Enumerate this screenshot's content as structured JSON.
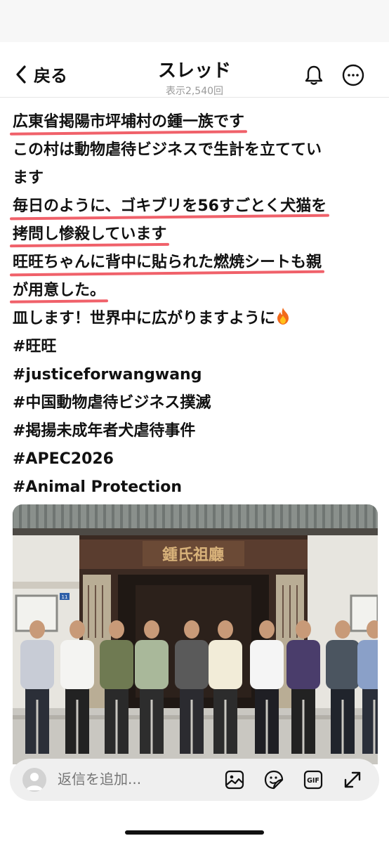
{
  "header": {
    "back_label": "戻る",
    "title": "スレッド",
    "views": "表示2,540回"
  },
  "post": {
    "lines": [
      "広東省掲陽市坪埔村の鍾一族です",
      "この村は動物虐待ビジネスで生計を立ててい",
      "ます",
      "毎日のように、ゴキブリを56すごとく犬猫を",
      "拷問し惨殺しています",
      "旺旺ちゃんに背中に貼られた燃焼シートも親",
      "が用意した。",
      "皿します！世界中に広がりますように",
      "#旺旺",
      "#justiceforwangwang",
      "#中国動物虐待ビジネス撲滅",
      "#掲揚未成年者犬虐待事件",
      "#APEC2026",
      "#Animal Protection"
    ]
  },
  "photo": {
    "sign_text": "鍾氏祖廳",
    "door_number": "11"
  },
  "reply": {
    "placeholder": "返信を追加..."
  },
  "icons": {
    "back": "chevron-left-icon",
    "bell": "bell-icon",
    "more": "more-icon",
    "image": "image-icon",
    "sticker": "sticker-icon",
    "gif": "gif-icon",
    "expand": "expand-icon"
  },
  "colors": {
    "highlight": "#f0616a",
    "accent": "#111111"
  }
}
